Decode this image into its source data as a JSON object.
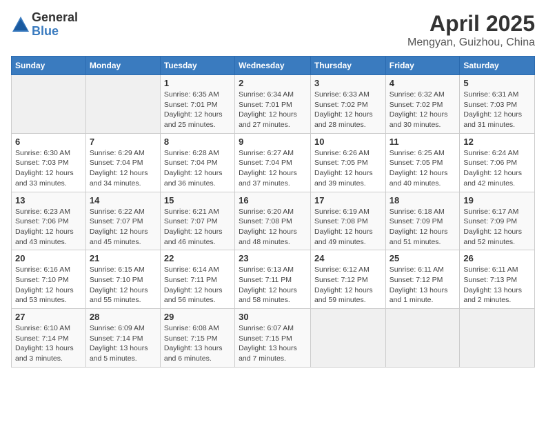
{
  "header": {
    "logo_general": "General",
    "logo_blue": "Blue",
    "month_title": "April 2025",
    "location": "Mengyan, Guizhou, China"
  },
  "days_of_week": [
    "Sunday",
    "Monday",
    "Tuesday",
    "Wednesday",
    "Thursday",
    "Friday",
    "Saturday"
  ],
  "weeks": [
    [
      {
        "day": "",
        "info": ""
      },
      {
        "day": "",
        "info": ""
      },
      {
        "day": "1",
        "info": "Sunrise: 6:35 AM\nSunset: 7:01 PM\nDaylight: 12 hours and 25 minutes."
      },
      {
        "day": "2",
        "info": "Sunrise: 6:34 AM\nSunset: 7:01 PM\nDaylight: 12 hours and 27 minutes."
      },
      {
        "day": "3",
        "info": "Sunrise: 6:33 AM\nSunset: 7:02 PM\nDaylight: 12 hours and 28 minutes."
      },
      {
        "day": "4",
        "info": "Sunrise: 6:32 AM\nSunset: 7:02 PM\nDaylight: 12 hours and 30 minutes."
      },
      {
        "day": "5",
        "info": "Sunrise: 6:31 AM\nSunset: 7:03 PM\nDaylight: 12 hours and 31 minutes."
      }
    ],
    [
      {
        "day": "6",
        "info": "Sunrise: 6:30 AM\nSunset: 7:03 PM\nDaylight: 12 hours and 33 minutes."
      },
      {
        "day": "7",
        "info": "Sunrise: 6:29 AM\nSunset: 7:04 PM\nDaylight: 12 hours and 34 minutes."
      },
      {
        "day": "8",
        "info": "Sunrise: 6:28 AM\nSunset: 7:04 PM\nDaylight: 12 hours and 36 minutes."
      },
      {
        "day": "9",
        "info": "Sunrise: 6:27 AM\nSunset: 7:04 PM\nDaylight: 12 hours and 37 minutes."
      },
      {
        "day": "10",
        "info": "Sunrise: 6:26 AM\nSunset: 7:05 PM\nDaylight: 12 hours and 39 minutes."
      },
      {
        "day": "11",
        "info": "Sunrise: 6:25 AM\nSunset: 7:05 PM\nDaylight: 12 hours and 40 minutes."
      },
      {
        "day": "12",
        "info": "Sunrise: 6:24 AM\nSunset: 7:06 PM\nDaylight: 12 hours and 42 minutes."
      }
    ],
    [
      {
        "day": "13",
        "info": "Sunrise: 6:23 AM\nSunset: 7:06 PM\nDaylight: 12 hours and 43 minutes."
      },
      {
        "day": "14",
        "info": "Sunrise: 6:22 AM\nSunset: 7:07 PM\nDaylight: 12 hours and 45 minutes."
      },
      {
        "day": "15",
        "info": "Sunrise: 6:21 AM\nSunset: 7:07 PM\nDaylight: 12 hours and 46 minutes."
      },
      {
        "day": "16",
        "info": "Sunrise: 6:20 AM\nSunset: 7:08 PM\nDaylight: 12 hours and 48 minutes."
      },
      {
        "day": "17",
        "info": "Sunrise: 6:19 AM\nSunset: 7:08 PM\nDaylight: 12 hours and 49 minutes."
      },
      {
        "day": "18",
        "info": "Sunrise: 6:18 AM\nSunset: 7:09 PM\nDaylight: 12 hours and 51 minutes."
      },
      {
        "day": "19",
        "info": "Sunrise: 6:17 AM\nSunset: 7:09 PM\nDaylight: 12 hours and 52 minutes."
      }
    ],
    [
      {
        "day": "20",
        "info": "Sunrise: 6:16 AM\nSunset: 7:10 PM\nDaylight: 12 hours and 53 minutes."
      },
      {
        "day": "21",
        "info": "Sunrise: 6:15 AM\nSunset: 7:10 PM\nDaylight: 12 hours and 55 minutes."
      },
      {
        "day": "22",
        "info": "Sunrise: 6:14 AM\nSunset: 7:11 PM\nDaylight: 12 hours and 56 minutes."
      },
      {
        "day": "23",
        "info": "Sunrise: 6:13 AM\nSunset: 7:11 PM\nDaylight: 12 hours and 58 minutes."
      },
      {
        "day": "24",
        "info": "Sunrise: 6:12 AM\nSunset: 7:12 PM\nDaylight: 12 hours and 59 minutes."
      },
      {
        "day": "25",
        "info": "Sunrise: 6:11 AM\nSunset: 7:12 PM\nDaylight: 13 hours and 1 minute."
      },
      {
        "day": "26",
        "info": "Sunrise: 6:11 AM\nSunset: 7:13 PM\nDaylight: 13 hours and 2 minutes."
      }
    ],
    [
      {
        "day": "27",
        "info": "Sunrise: 6:10 AM\nSunset: 7:14 PM\nDaylight: 13 hours and 3 minutes."
      },
      {
        "day": "28",
        "info": "Sunrise: 6:09 AM\nSunset: 7:14 PM\nDaylight: 13 hours and 5 minutes."
      },
      {
        "day": "29",
        "info": "Sunrise: 6:08 AM\nSunset: 7:15 PM\nDaylight: 13 hours and 6 minutes."
      },
      {
        "day": "30",
        "info": "Sunrise: 6:07 AM\nSunset: 7:15 PM\nDaylight: 13 hours and 7 minutes."
      },
      {
        "day": "",
        "info": ""
      },
      {
        "day": "",
        "info": ""
      },
      {
        "day": "",
        "info": ""
      }
    ]
  ]
}
